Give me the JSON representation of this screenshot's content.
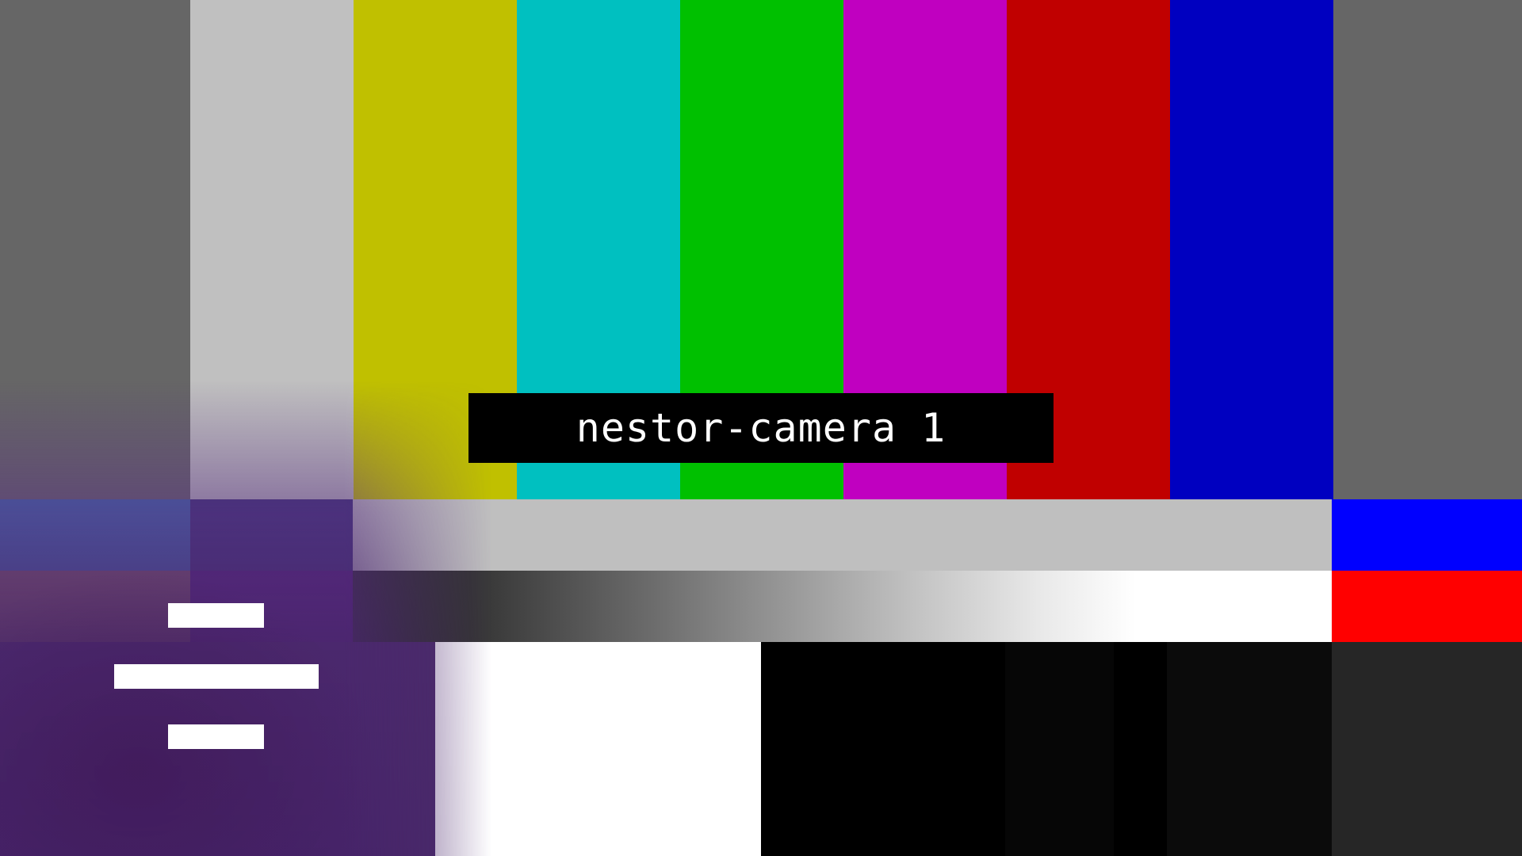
{
  "camera_label": "nestor-camera 1",
  "colors": {
    "top_bars": [
      "#666666",
      "#c0c0c0",
      "#c0c000",
      "#00c0c0",
      "#00c000",
      "#c000c0",
      "#c00000",
      "#0000c0",
      "#666666"
    ],
    "middle_row": [
      "#3a6aaa",
      "#3a3075",
      "#bfbfbf",
      "#0000ff"
    ],
    "ramp_row": [
      "#86605a",
      "#4f1c78",
      "ramp",
      "#ff0000"
    ],
    "pluge_row": [
      "#4a2b6a",
      "#ffffff",
      "#000000",
      "#060606",
      "#000000",
      "#0b0b0b",
      "#262626"
    ]
  }
}
